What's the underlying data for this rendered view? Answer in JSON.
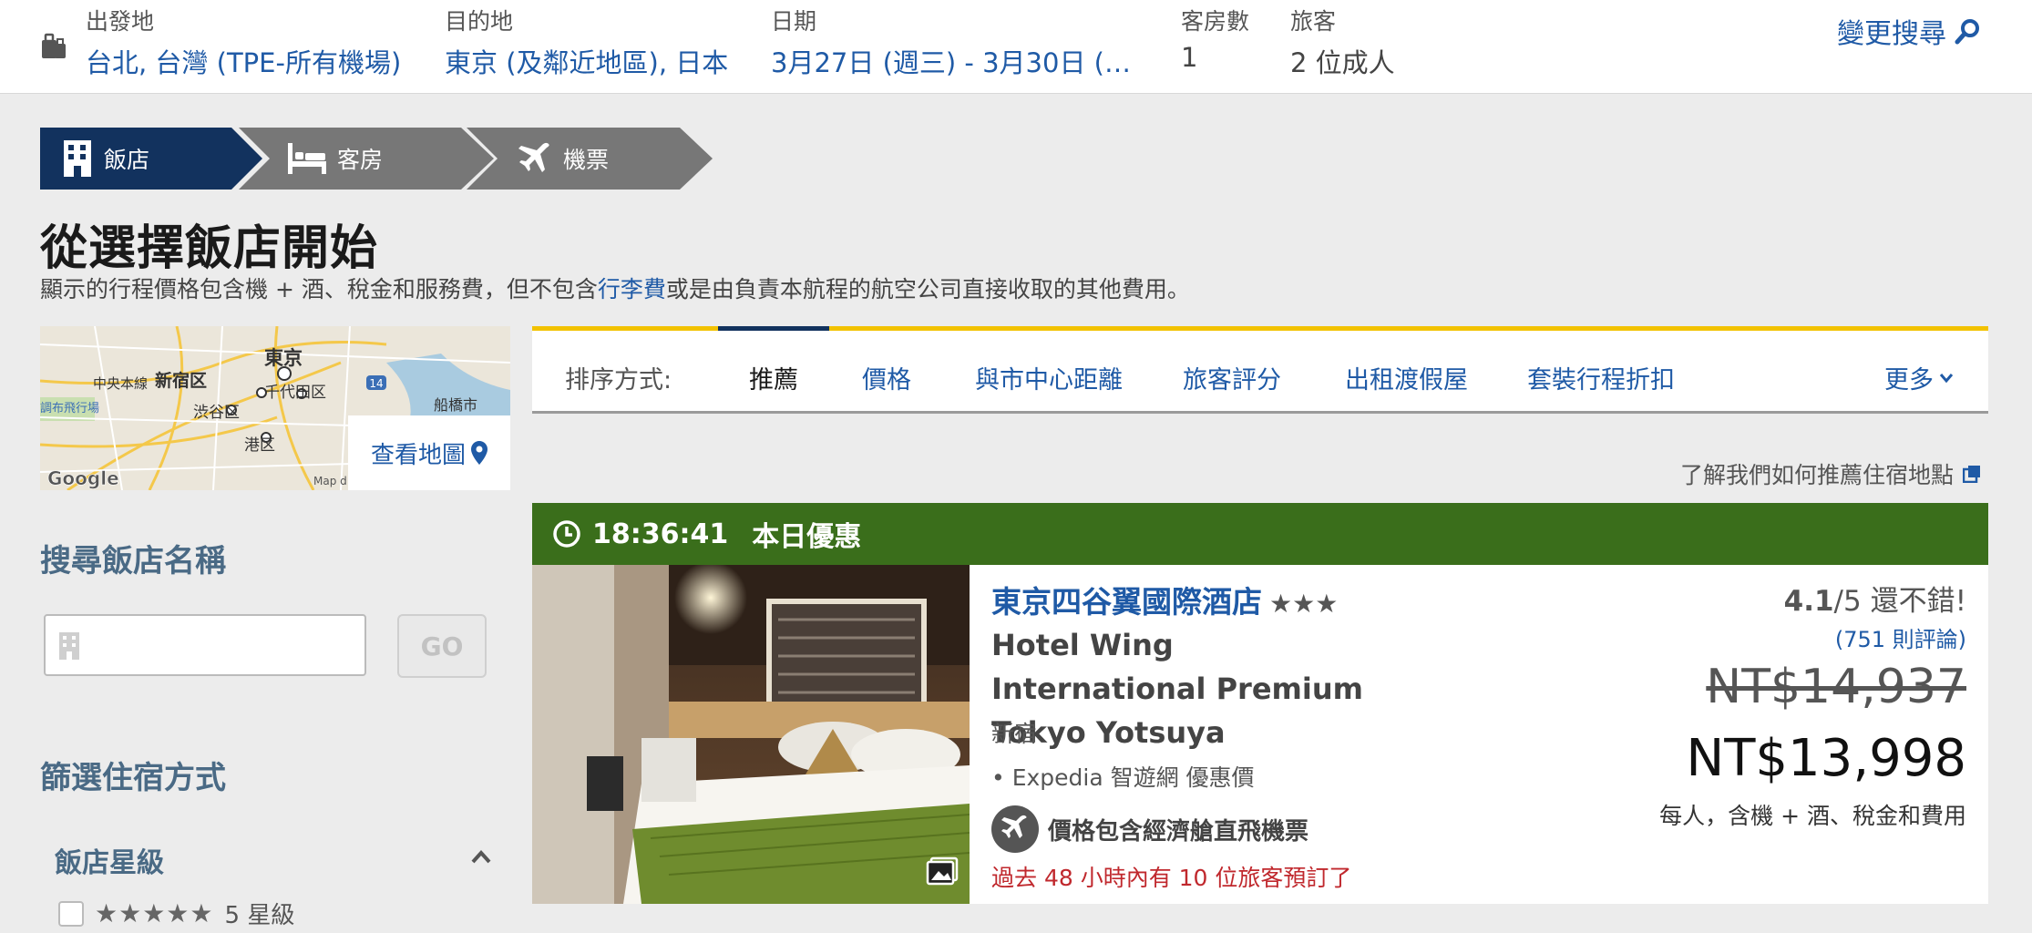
{
  "search": {
    "origin_label": "出發地",
    "origin_value": "台北, 台灣 (TPE-所有機場)",
    "destination_label": "目的地",
    "destination_value": "東京 (及鄰近地區), 日本",
    "dates_label": "日期",
    "dates_value": "3月27日 (週三) - 3月30日 (…",
    "rooms_label": "客房數",
    "rooms_value": "1",
    "travelers_label": "旅客",
    "travelers_value": "2 位成人",
    "change_label": "變更搜尋"
  },
  "steps": [
    "飯店",
    "客房",
    "機票"
  ],
  "page": {
    "title": "從選擇飯店開始",
    "subtitle_before": "顯示的行程價格包含機 + 酒、稅金和服務費，但不包含",
    "subtitle_link": "行李費",
    "subtitle_after": "或是由負責本航程的航空公司直接收取的其他費用。"
  },
  "map": {
    "labels": [
      "東京",
      "中央本線",
      "新宿区",
      "千代田区",
      "渋谷区",
      "港区",
      "船橋市",
      "調布飛行場",
      "14"
    ],
    "brand": "Google",
    "credit": "Map d",
    "button_label": "查看地圖"
  },
  "filters": {
    "search_name_heading": "搜尋飯店名稱",
    "go_label": "GO",
    "accommodation_heading": "篩選住宿方式",
    "star_heading": "飯店星級",
    "star_option_stars": "★★★★★",
    "star_option_label": "5 星級"
  },
  "sort": {
    "label": "排序方式:",
    "options": [
      "推薦",
      "價格",
      "與市中心距離",
      "旅客評分",
      "出租渡假屋",
      "套裝行程折扣"
    ],
    "active": "推薦",
    "more": "更多"
  },
  "learn_link": "了解我們如何推薦住宿地點",
  "deal": {
    "timer": "18:36:41",
    "label": "本日優惠"
  },
  "hotel": {
    "name_zh": "東京四谷翼國際酒店",
    "stars": "★★★",
    "name_en": "Hotel Wing International Premium Tokyo Yotsuya",
    "area": "新宿",
    "partner": "• Expedia 智遊網 優惠價",
    "flight_note": "價格包含經濟艙直飛機票",
    "booked_note": "過去 48 小時內有 10 位旅客預訂了",
    "rating_score": "4.1",
    "rating_suffix": "/5 還不錯!",
    "reviews": "(751 則評論)",
    "old_price": "NT$14,937",
    "new_price": "NT$13,998",
    "price_note": "每人，含機 + 酒、稅金和費用"
  },
  "colors": {
    "link": "#1f5aa6",
    "step_active": "#12325e",
    "step_inactive": "#777777",
    "deal_green": "#3a6e1b",
    "sort_accent": "#f2c200",
    "urgency_red": "#c0282d"
  }
}
